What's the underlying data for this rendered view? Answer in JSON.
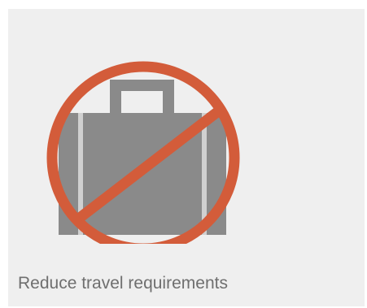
{
  "card": {
    "caption": "Reduce travel requirements"
  },
  "icon": {
    "name": "no-travel-icon",
    "prohibition_color": "#d35c3a",
    "briefcase_color": "#8a8a8a",
    "background_color": "#efefef"
  }
}
